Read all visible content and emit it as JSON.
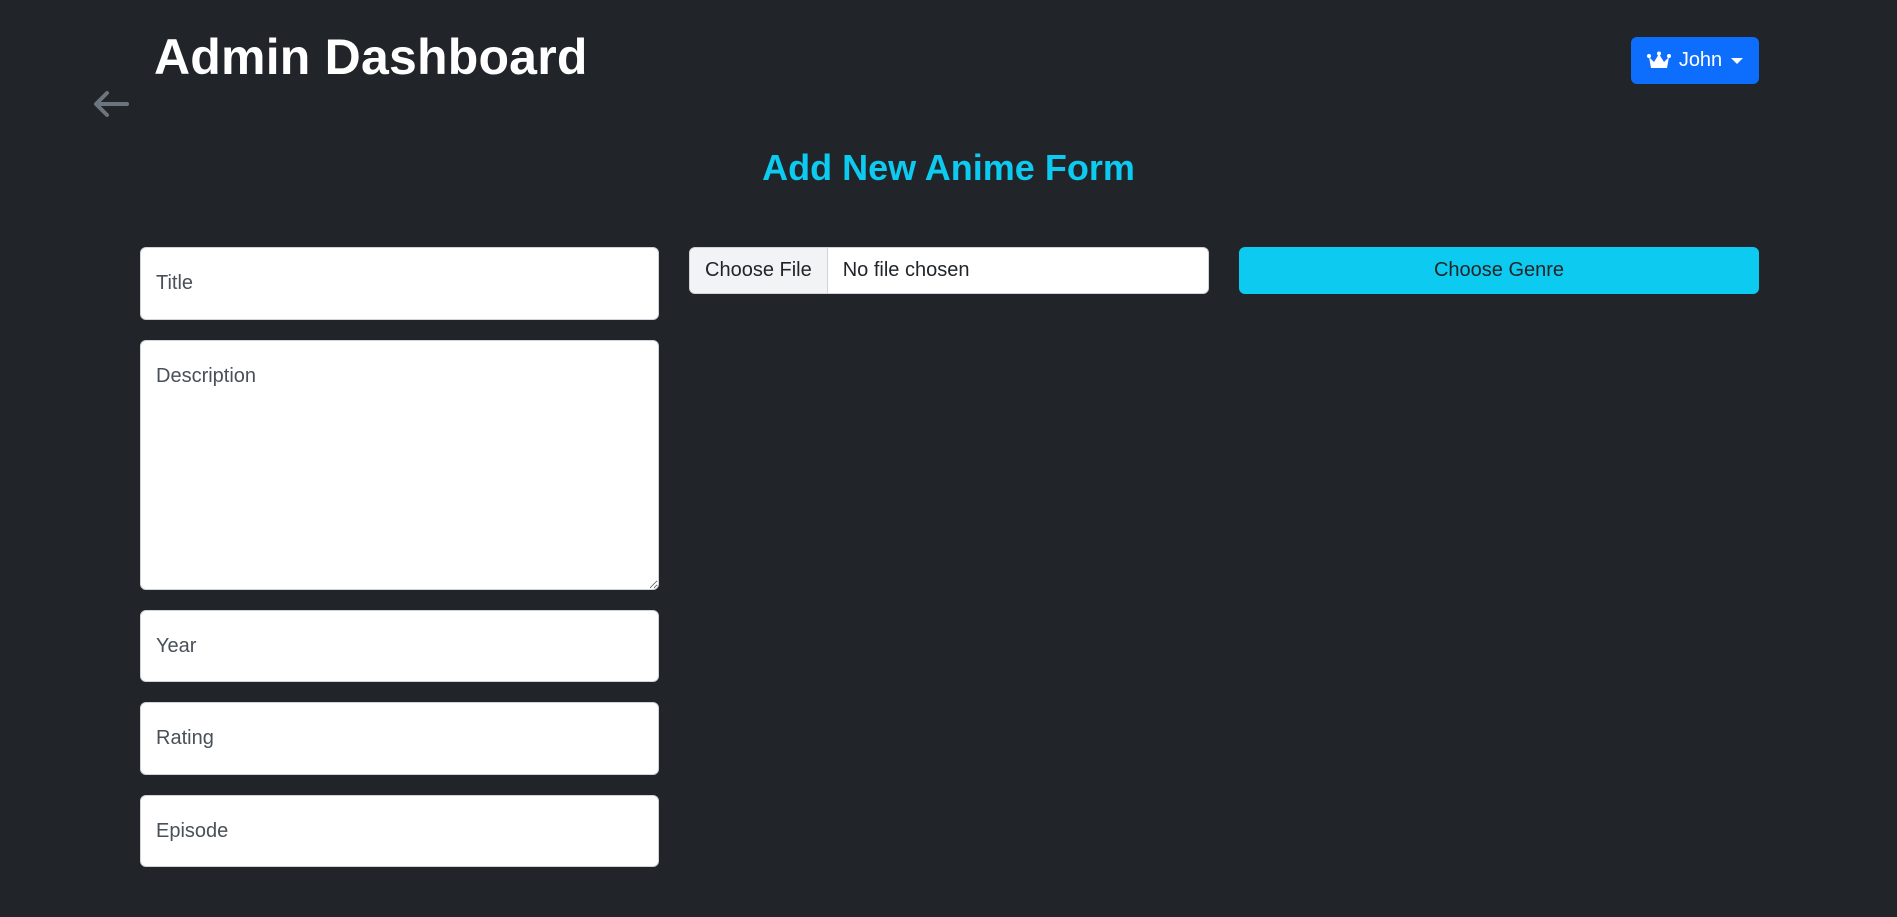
{
  "header": {
    "title": "Admin Dashboard",
    "back_icon": "arrow-left-icon",
    "user_menu": {
      "icon": "crown-icon",
      "username": "John",
      "caret_icon": "caret-down-icon"
    }
  },
  "form": {
    "heading": "Add New Anime Form",
    "fields": {
      "title": {
        "value": "",
        "placeholder": "Title"
      },
      "description": {
        "value": "",
        "placeholder": "Description"
      },
      "year": {
        "value": "",
        "placeholder": "Year"
      },
      "rating": {
        "value": "",
        "placeholder": "Rating"
      },
      "episode": {
        "value": "",
        "placeholder": "Episode"
      }
    },
    "file_input": {
      "button_label": "Choose File",
      "status": "No file chosen"
    },
    "genre_button": {
      "label": "Choose Genre"
    }
  },
  "colors": {
    "background": "#212529",
    "accent_cyan": "#0dcaf0",
    "primary_blue": "#0d6efd",
    "icon_gray": "#6c757d"
  }
}
